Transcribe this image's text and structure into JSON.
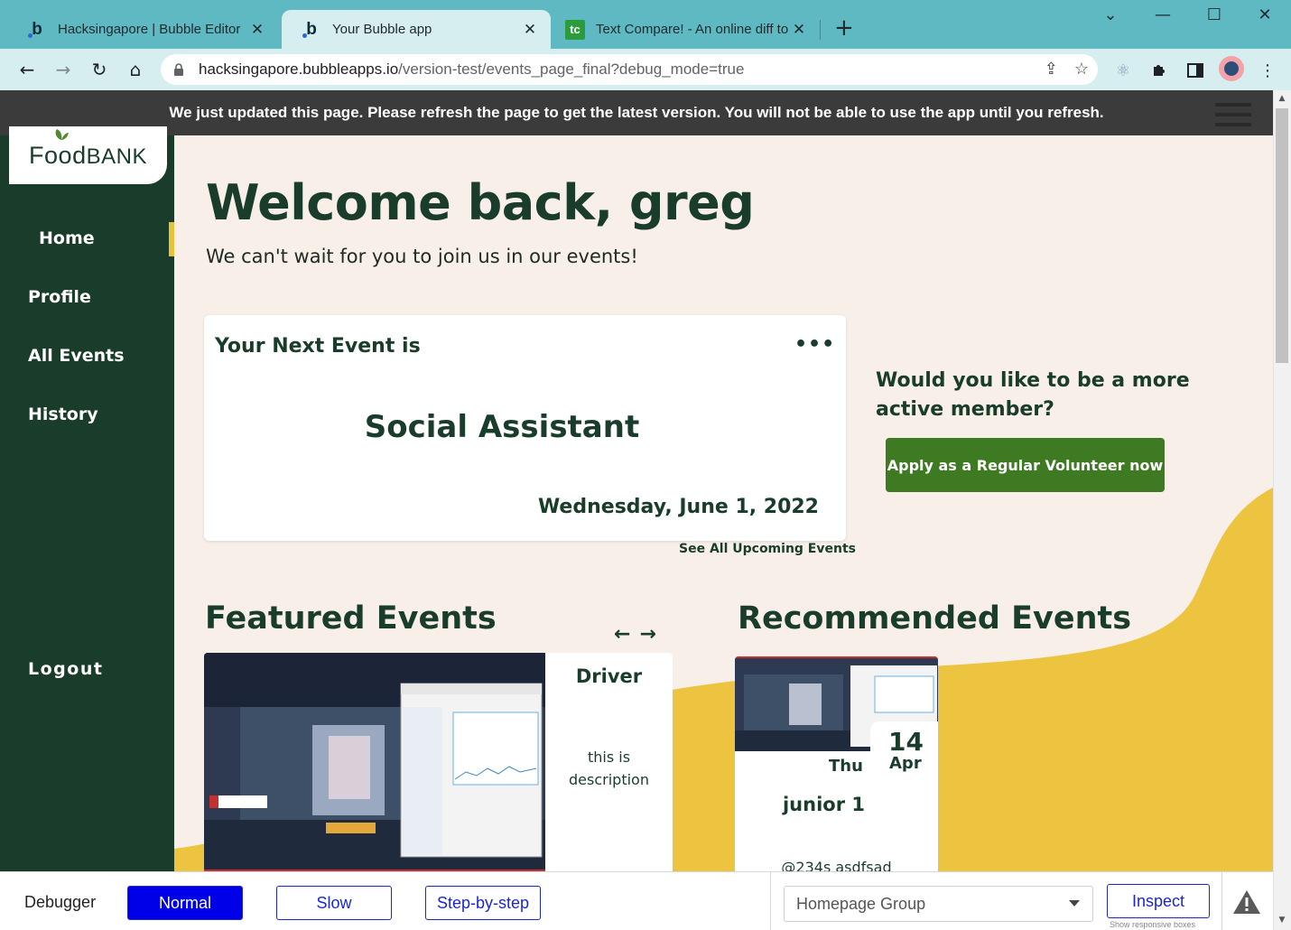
{
  "browser": {
    "tabs": [
      {
        "title": "Hacksingapore | Bubble Editor",
        "icon": "bubble-icon",
        "active": false
      },
      {
        "title": "Your Bubble app",
        "icon": "bubble-icon",
        "active": true
      },
      {
        "title": "Text Compare! - An online diff to",
        "icon": "textcompare-icon",
        "active": false,
        "icon_text": "tc"
      }
    ],
    "new_tab": "+",
    "url_host": "hacksingapore.bubbleapps.io",
    "url_path": "/version-test/events_page_final?debug_mode=true"
  },
  "page": {
    "notice": "We just updated this page. Please refresh the page to get the latest version. You will not be able to use the app until you refresh.",
    "logo": {
      "text_food": "Food",
      "text_bank": "BANK"
    },
    "nav": {
      "home": "Home",
      "profile": "Profile",
      "all_events": "All Events",
      "history": "History",
      "logout": "Logout"
    },
    "welcome": "Welcome back, greg",
    "subwelcome": "We can't wait for you to join us in our events!",
    "next_event": {
      "heading": "Your Next Event is",
      "menu": "•••",
      "name": "Social Assistant",
      "date": "Wednesday, June 1, 2022"
    },
    "see_all": "See All Upcoming Events",
    "promo": {
      "question": "Would you like to be a more active member?",
      "button": "Apply as a Regular Volunteer now"
    },
    "featured": {
      "title": "Featured Events",
      "prev": "←",
      "next": "→",
      "card": {
        "name": "Driver",
        "description": "this is description"
      }
    },
    "recommended": {
      "title": "Recommended Events",
      "card": {
        "day": "14",
        "month": "Apr",
        "weekday": "Thu",
        "name": "junior 1",
        "organizer": "@234s asdfsad"
      }
    },
    "colors": {
      "sidebar": "#1a3c2a",
      "accent_yellow": "#edc43f",
      "button_green": "#3d7a22",
      "background": "#f8efe9"
    }
  },
  "debugger": {
    "label": "Debugger",
    "modes": [
      "Normal",
      "Slow",
      "Step-by-step"
    ],
    "active_mode": "Normal",
    "element_select": "Homepage Group",
    "inspect": "Inspect",
    "hint": "Show responsive boxes"
  }
}
